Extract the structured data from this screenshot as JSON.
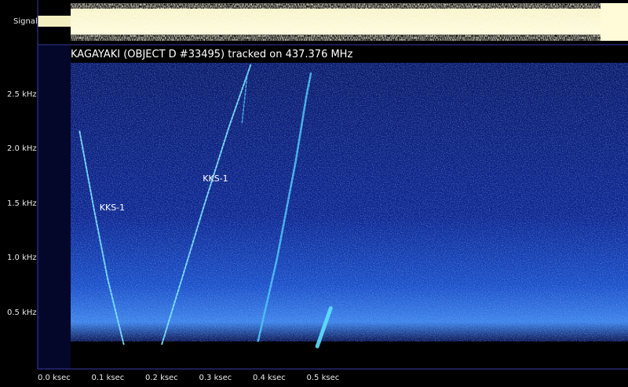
{
  "signal_panel": {
    "label": "Signal"
  },
  "chart_data": {
    "type": "heatmap",
    "title": "KAGAYAKI  (OBJECT D #33495) tracked on 437.376 MHz",
    "xlabel": "",
    "ylabel": "",
    "x_unit": "ksec",
    "y_unit": "kHz",
    "xlim": [
      0.0,
      0.545
    ],
    "ylim": [
      0.1,
      2.9
    ],
    "x_ticks": [
      {
        "value": 0.0,
        "label": "0.0 ksec"
      },
      {
        "value": 0.1,
        "label": "0.1 ksec"
      },
      {
        "value": 0.2,
        "label": "0.2 ksec"
      },
      {
        "value": 0.3,
        "label": "0.3 ksec"
      },
      {
        "value": 0.4,
        "label": "0.4 ksec"
      },
      {
        "value": 0.5,
        "label": "0.5 ksec"
      }
    ],
    "y_ticks": [
      {
        "value": 0.5,
        "label": "0.5 kHz"
      },
      {
        "value": 1.0,
        "label": "1.0 kHz"
      },
      {
        "value": 1.5,
        "label": "1.5 kHz"
      },
      {
        "value": 2.0,
        "label": "2.0 kHz"
      },
      {
        "value": 2.5,
        "label": "2.5 kHz"
      }
    ],
    "traces": [
      {
        "name": "KKS-1",
        "points": [
          [
            0.078,
            2.17
          ],
          [
            0.105,
            1.45
          ],
          [
            0.13,
            0.82
          ],
          [
            0.152,
            0.38
          ],
          [
            0.16,
            0.22
          ]
        ],
        "width": 2.0,
        "color": "#7fe6ff"
      },
      {
        "name": "KKS-1",
        "points": [
          [
            0.231,
            0.22
          ],
          [
            0.27,
            0.85
          ],
          [
            0.31,
            1.5
          ],
          [
            0.355,
            2.2
          ],
          [
            0.396,
            2.78
          ]
        ],
        "width": 2.0,
        "color": "#7fe6ff"
      },
      {
        "name": "",
        "points": [
          [
            0.41,
            0.25
          ],
          [
            0.445,
            1.0
          ],
          [
            0.48,
            1.9
          ],
          [
            0.5,
            2.5
          ],
          [
            0.508,
            2.7
          ]
        ],
        "width": 2.6,
        "color": "#4fc0f5"
      },
      {
        "name": "",
        "points": [
          [
            0.38,
            2.25
          ],
          [
            0.39,
            2.7
          ]
        ],
        "width": 1.5,
        "color": "#4fb0ee"
      },
      {
        "name": "",
        "points": [
          [
            0.52,
            0.2
          ],
          [
            0.545,
            0.55
          ]
        ],
        "width": 5,
        "color": "#5fe0ff"
      }
    ],
    "annotations": [
      {
        "text": "KKS-1",
        "x": 0.115,
        "y": 1.46
      },
      {
        "text": "KKS-1",
        "x": 0.307,
        "y": 1.73
      }
    ]
  }
}
